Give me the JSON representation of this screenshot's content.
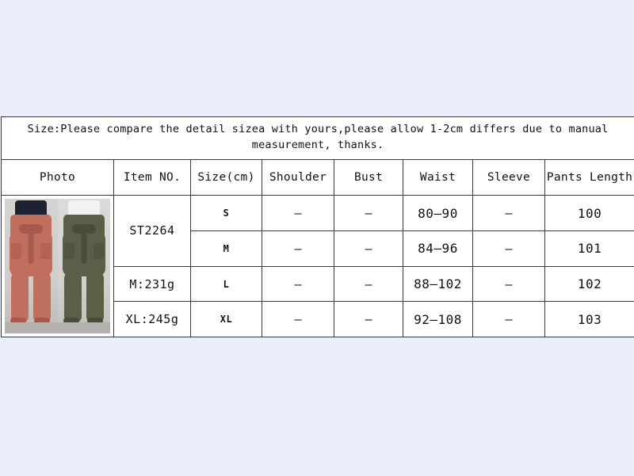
{
  "background_color": "#eaeffb",
  "note": {
    "line1": "Size:Please compare the detail sizea with yours,please allow 1-2cm differs due to manual",
    "line2": "measurement, thanks."
  },
  "columns": [
    "Photo",
    "Item NO.",
    "Size(cm)",
    "Shoulder",
    "Bust",
    "Waist",
    "Sleeve",
    "Pants Length"
  ],
  "item_info": {
    "item_no": "ST2264",
    "weight_m": "M:231g",
    "weight_xl": "XL:245g"
  },
  "rows": [
    {
      "size": "S",
      "shoulder": "–",
      "bust": "–",
      "waist": "80–90",
      "sleeve": "–",
      "pants_length": "100"
    },
    {
      "size": "M",
      "shoulder": "–",
      "bust": "–",
      "waist": "84–96",
      "sleeve": "–",
      "pants_length": "101"
    },
    {
      "size": "L",
      "shoulder": "–",
      "bust": "–",
      "waist": "88–102",
      "sleeve": "–",
      "pants_length": "102"
    },
    {
      "size": "XL",
      "shoulder": "–",
      "bust": "–",
      "waist": "92–108",
      "sleeve": "–",
      "pants_length": "103"
    }
  ],
  "photo": {
    "name": "product-photo-paperbag-pants",
    "left_model_color": "#c06e5e",
    "right_model_color": "#5a6048"
  }
}
